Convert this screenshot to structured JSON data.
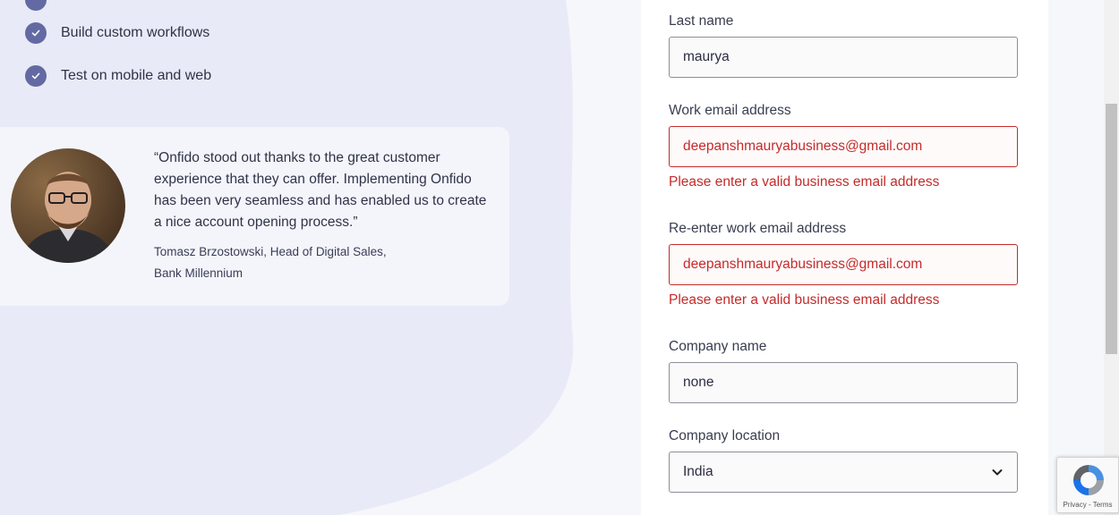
{
  "features": [
    {
      "label": "Build custom workflows"
    },
    {
      "label": "Test on mobile and web"
    }
  ],
  "testimonial": {
    "quote": "“Onfido stood out thanks to the great customer experience that they can offer. Implementing Onfido has been very seamless and has enabled us to create a nice account opening process.”",
    "author_line1": "Tomasz Brzostowski, Head of Digital Sales,",
    "author_line2": "Bank Millennium"
  },
  "form": {
    "last_name": {
      "label": "Last name",
      "value": "maurya"
    },
    "work_email": {
      "label": "Work email address",
      "value": "deepanshmauryabusiness@gmail.com",
      "error": "Please enter a valid business email address"
    },
    "reenter_email": {
      "label": "Re-enter work email address",
      "value": "deepanshmauryabusiness@gmail.com",
      "error": "Please enter a valid business email address"
    },
    "company_name": {
      "label": "Company name",
      "value": "none"
    },
    "company_location": {
      "label": "Company location",
      "value": "India"
    }
  },
  "recaptcha": {
    "text": "Privacy - Terms"
  },
  "colors": {
    "accent": "#636aa3",
    "error": "#c42b2b"
  }
}
